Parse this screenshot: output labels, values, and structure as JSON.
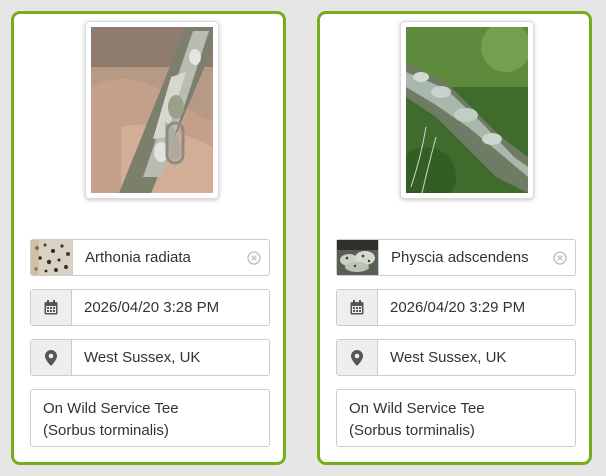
{
  "cards": [
    {
      "species": "Arthonia radiata",
      "datetime": "2026/04/20 3:28 PM",
      "location": "West Sussex, UK",
      "note": "On Wild Service Tee\n(Sorbus torminalis)"
    },
    {
      "species": "Physcia adscendens",
      "datetime": "2026/04/20 3:29 PM",
      "location": "West Sussex, UK",
      "note": "On Wild Service Tee\n(Sorbus torminalis)"
    }
  ],
  "colors": {
    "card_border": "#76ad1c",
    "background": "#e6e6e6",
    "addon_bg": "#eeeeee",
    "text": "#333333"
  },
  "icons": [
    "calendar-icon",
    "map-marker-icon",
    "clear-icon"
  ]
}
